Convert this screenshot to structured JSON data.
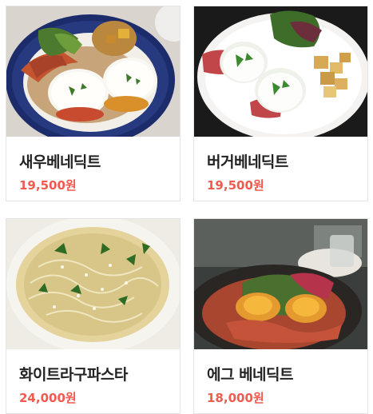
{
  "menu": {
    "items": [
      {
        "name": "새우베네딕트",
        "price": "19,500원",
        "image_icon": "shrimp-benedict-photo-icon"
      },
      {
        "name": "버거베네딕트",
        "price": "19,500원",
        "image_icon": "burger-benedict-photo-icon"
      },
      {
        "name": "화이트라구파스타",
        "price": "24,000원",
        "image_icon": "white-ragu-pasta-photo-icon"
      },
      {
        "name": "에그 베네딕트",
        "price": "18,000원",
        "image_icon": "egg-benedict-photo-icon"
      }
    ]
  },
  "colors": {
    "price": "#f05a4f",
    "name": "#222222",
    "card_border": "#e4e4e4"
  }
}
